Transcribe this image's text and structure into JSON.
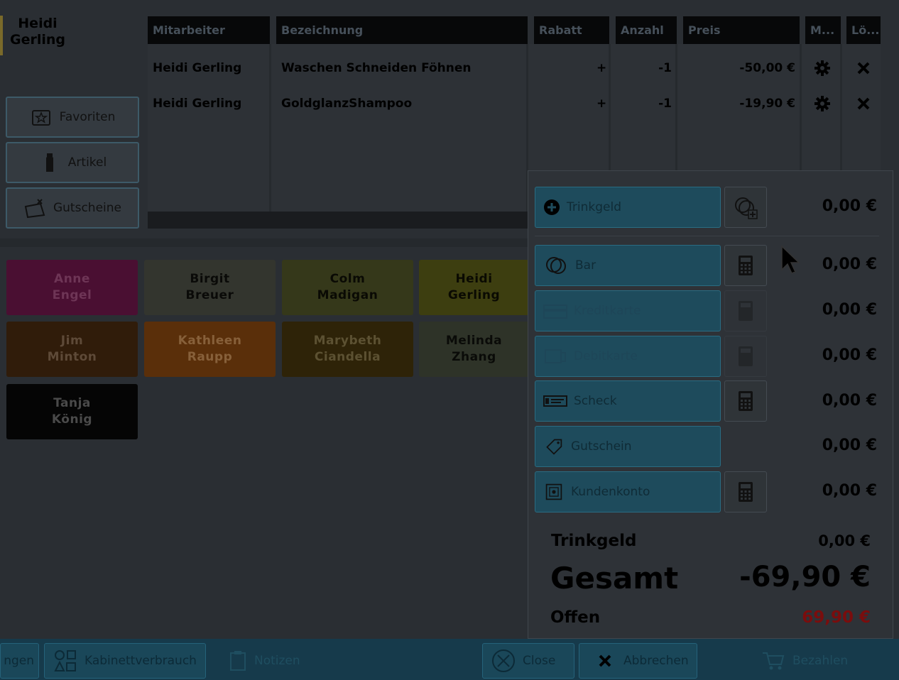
{
  "customer": {
    "name_line1": "Heidi",
    "name_line2": "Gerling"
  },
  "nav": {
    "favorites": "Favoriten",
    "articles": "Artikel",
    "vouchers": "Gutscheine"
  },
  "table": {
    "headers": [
      "Mitarbeiter",
      "Bezeichnung",
      "Rabatt",
      "Anzahl",
      "Preis",
      "M...",
      "Lö..."
    ],
    "rows": [
      {
        "employee": "Heidi Gerling",
        "description": "Waschen Schneiden Föhnen",
        "discount": "+",
        "quantity": "-1",
        "price": "-50,00 €"
      },
      {
        "employee": "Heidi Gerling",
        "description": "GoldglanzShampoo",
        "discount": "+",
        "quantity": "-1",
        "price": "-19,90 €"
      }
    ]
  },
  "employees": [
    {
      "line1": "Anne",
      "line2": "Engel",
      "bg": "#4a0f32",
      "fg": "#6e3556"
    },
    {
      "line1": "Birgit",
      "line2": "Breuer",
      "bg": "#33352e",
      "fg": "#0a0a08"
    },
    {
      "line1": "Colm",
      "line2": "Madigan",
      "bg": "#35381a",
      "fg": "#0a0a04"
    },
    {
      "line1": "Heidi",
      "line2": "Gerling",
      "bg": "#3d3e10",
      "fg": "#0a0a02"
    },
    {
      "line1": "Jim",
      "line2": "Minton",
      "bg": "#301c0a",
      "fg": "#5e4a38"
    },
    {
      "line1": "Kathleen",
      "line2": "Raupp",
      "bg": "#5a2f0a",
      "fg": "#87603a"
    },
    {
      "line1": "Marybeth",
      "line2": "Ciandella",
      "bg": "#2e2308",
      "fg": "#5c5132"
    },
    {
      "line1": "Melinda",
      "line2": "Zhang",
      "bg": "#2e3328",
      "fg": "#0a0b08"
    },
    {
      "line1": "Tanja",
      "line2": "König",
      "bg": "#050505",
      "fg": "#4a4a4a"
    }
  ],
  "payment": {
    "tip_button": "Trinkgeld",
    "tip_amount": "0,00 €",
    "methods": [
      {
        "label": "Bar",
        "amount": "0,00 €"
      },
      {
        "label": "Kreditkarte",
        "amount": "0,00 €"
      },
      {
        "label": "Debitkarte",
        "amount": "0,00 €"
      },
      {
        "label": "Scheck",
        "amount": "0,00 €"
      },
      {
        "label": "Gutschein",
        "amount": "0,00 €"
      },
      {
        "label": "Kundenkonto",
        "amount": "0,00 €"
      }
    ],
    "summary": {
      "tip_label": "Trinkgeld",
      "tip_value": "0,00 €",
      "total_label": "Gesamt",
      "total_value": "-69,90 €",
      "open_label": "Offen",
      "open_value": "69,90 €"
    },
    "open_color": "#7a0d0d"
  },
  "bottom": {
    "partial": "ngen",
    "cabinet": "Kabinettverbrauch",
    "notes": "Notizen",
    "close": "Close",
    "cancel": "Abbrechen",
    "pay": "Bezahlen"
  },
  "icons": {
    "favorites": "star-folder-icon",
    "articles": "bottle-icon",
    "vouchers": "voucher-icon",
    "settings": "gear-icon",
    "delete": "close-x-icon",
    "calculator": "calculator-icon",
    "cursor": "mouse-pointer-icon"
  }
}
